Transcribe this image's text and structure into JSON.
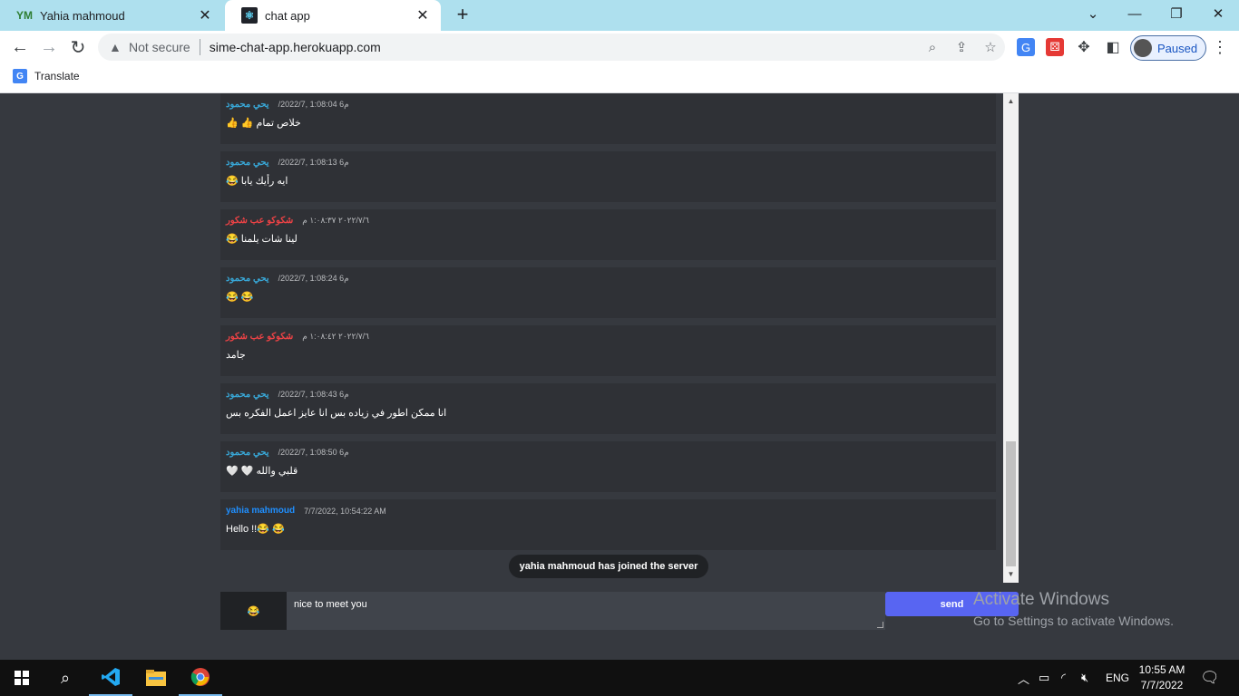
{
  "browser": {
    "tabs": [
      {
        "title": "Yahia mahmoud",
        "favicon": "YM"
      },
      {
        "title": "chat app",
        "favicon": "react-icon"
      }
    ],
    "security_label": "Not secure",
    "url": "sime-chat-app.herokuapp.com",
    "profile_label": "Paused",
    "bookmark_label": "Translate"
  },
  "colors": {
    "author_arabic_1": "#38a8d8",
    "author_arabic_2": "#ed4245",
    "author_english": "#1f8fff",
    "send_button": "#5865f2",
    "message_bg": "#2f3136",
    "page_bg": "#36393f"
  },
  "messages": [
    {
      "author": "يحي محمود",
      "timestamp": "/2022/7, 1:08:04 م6",
      "text": "👍 👍 خلاص تمام",
      "color_key": "author_arabic_1"
    },
    {
      "author": "يحي محمود",
      "timestamp": "/2022/7, 1:08:13 م6",
      "text": "😂 ايه رأيك يابا",
      "color_key": "author_arabic_1"
    },
    {
      "author": "شكوكو عب شكور",
      "timestamp": "٢٠٢٢/٧/٦ ١:٠٨:٣٧ م",
      "text": "😂 لينا شات يلمنا",
      "color_key": "author_arabic_2"
    },
    {
      "author": "يحي محمود",
      "timestamp": "/2022/7, 1:08:24 م6",
      "text": "😂 😂",
      "color_key": "author_arabic_1"
    },
    {
      "author": "شكوكو عب شكور",
      "timestamp": "٢٠٢٢/٧/٦ ١:٠٨:٤٢ م",
      "text": "جامد",
      "color_key": "author_arabic_2"
    },
    {
      "author": "يحي محمود",
      "timestamp": "/2022/7, 1:08:43 م6",
      "text": "انا ممكن اطور في زياده بس انا عايز اعمل الفكره بس",
      "color_key": "author_arabic_1"
    },
    {
      "author": "يحي محمود",
      "timestamp": "/2022/7, 1:08:50 م6",
      "text": "🤍 🤍 قلبي والله",
      "color_key": "author_arabic_1"
    },
    {
      "author": "yahia mahmoud",
      "timestamp": "7/7/2022, 10:54:22 AM",
      "text": "Hello !!😂 😂",
      "color_key": "author_english"
    }
  ],
  "join_notice": "yahia mahmoud has joined the server",
  "composer": {
    "emoji": "😂",
    "input_value": "nice to meet you",
    "send_label": "send"
  },
  "watermark": {
    "line1": "Activate Windows",
    "line2": "Go to Settings to activate Windows."
  },
  "taskbar": {
    "language": "ENG",
    "time": "10:55 AM",
    "date": "7/7/2022"
  }
}
